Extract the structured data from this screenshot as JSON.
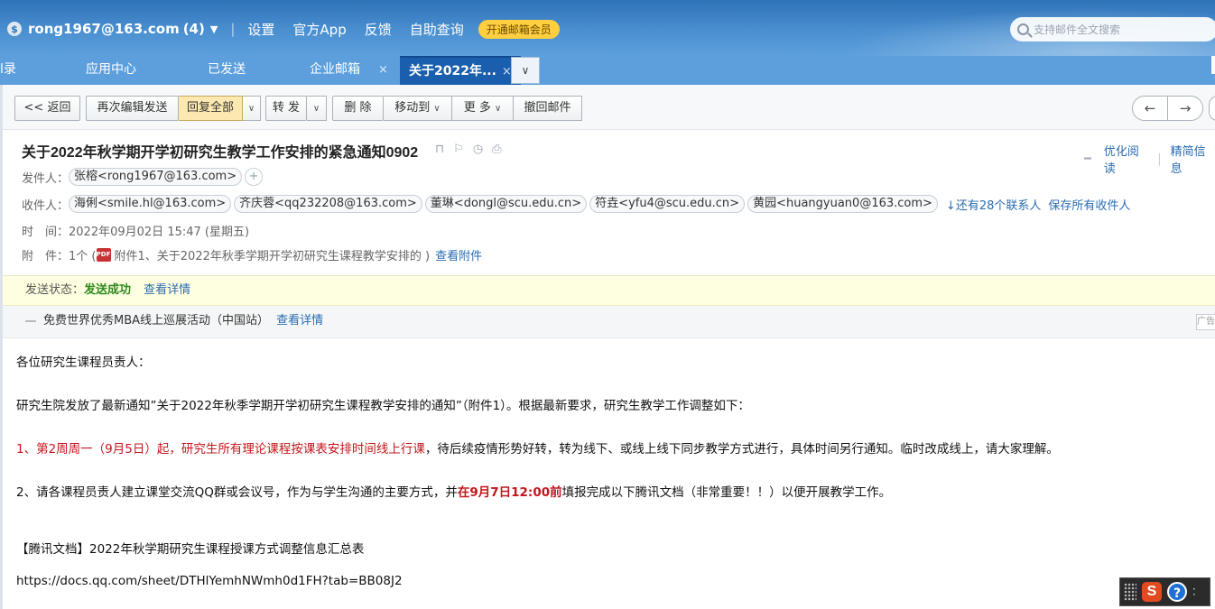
{
  "header": {
    "account": "rong1967@163.com",
    "unread": "(4)",
    "links": [
      "设置",
      "官方App",
      "反馈",
      "自助查询"
    ],
    "vip_label": "开通邮箱会员",
    "search_placeholder": "支持邮件全文搜索"
  },
  "tabs": [
    {
      "label": "l录"
    },
    {
      "label": "应用中心"
    },
    {
      "label": "已发送"
    },
    {
      "label": "企业邮箱"
    },
    {
      "label": "关于2022年..."
    }
  ],
  "toolbar": {
    "back": "<< 返回",
    "reedit": "再次编辑发送",
    "reply_all": "回复全部",
    "forward": "转 发",
    "delete": "删 除",
    "move": "移动到",
    "more": "更 多",
    "recall": "撤回邮件"
  },
  "mail": {
    "subject": "关于2022年秋学期开学初研究生教学工作安排的紧急通知0902",
    "optimize_reading": "优化阅读",
    "brief_info": "精简信息",
    "sender_label": "发件人：",
    "sender": "张榕<rong1967@163.com>",
    "recipients_label": "收件人：",
    "recipients": [
      "海俐<smile.hl@163.com>",
      "齐庆蓉<qq232208@163.com>",
      "董琳<dongl@scu.edu.cn>",
      "符垚<yfu4@scu.edu.cn>",
      "黄园<huangyuan0@163.com>"
    ],
    "more_contacts": "↓还有28个联系人",
    "save_recipients": "保存所有收件人",
    "time_label": "时　间：",
    "time": "2022年09月02日 15:47 (星期五)",
    "attach_label": "附　件：",
    "attach_count": "1个 (",
    "attach_name": "附件1、关于2022年秋季学期开学初研究生课程教学安排的 )",
    "view_attach": "查看附件"
  },
  "status": {
    "label": "发送状态：",
    "value": "发送成功",
    "detail": "查看详情"
  },
  "ad": {
    "text": "免费世界优秀MBA线上巡展活动（中国站）",
    "detail": "查看详情",
    "tag": "广告"
  },
  "body": {
    "greeting": "各位研究生课程员责人：",
    "p1": "研究生院发放了最新通知”关于2022年秋季学期开学初研究生课程教学安排的通知”（附件1）。根据最新要求，研究生教学工作调整如下：",
    "p2_red": "1、第2周周一（9月5日）起，研究生所有理论课程按课表安排时间线上行课",
    "p2_rest": "，待后续疫情形势好转，转为线下、或线上线下同步教学方式进行，具体时间另行通知。临时改成线上，请大家理解。",
    "p3_a": "2、请各课程员责人建立课堂交流QQ群或会议号，作为与学生沟通的主要方式，并",
    "p3_bold": "在9月7日12:00前",
    "p3_b": "填报完成以下腾讯文档（非常重要！！）以便开展教学工作。",
    "doc_title": "【腾讯文档】2022年秋学期研究生课程授课方式调整信息汇总表",
    "doc_url": "https://docs.qq.com/sheet/DTHlYemhNWmh0d1FH?tab=BB08J2"
  }
}
